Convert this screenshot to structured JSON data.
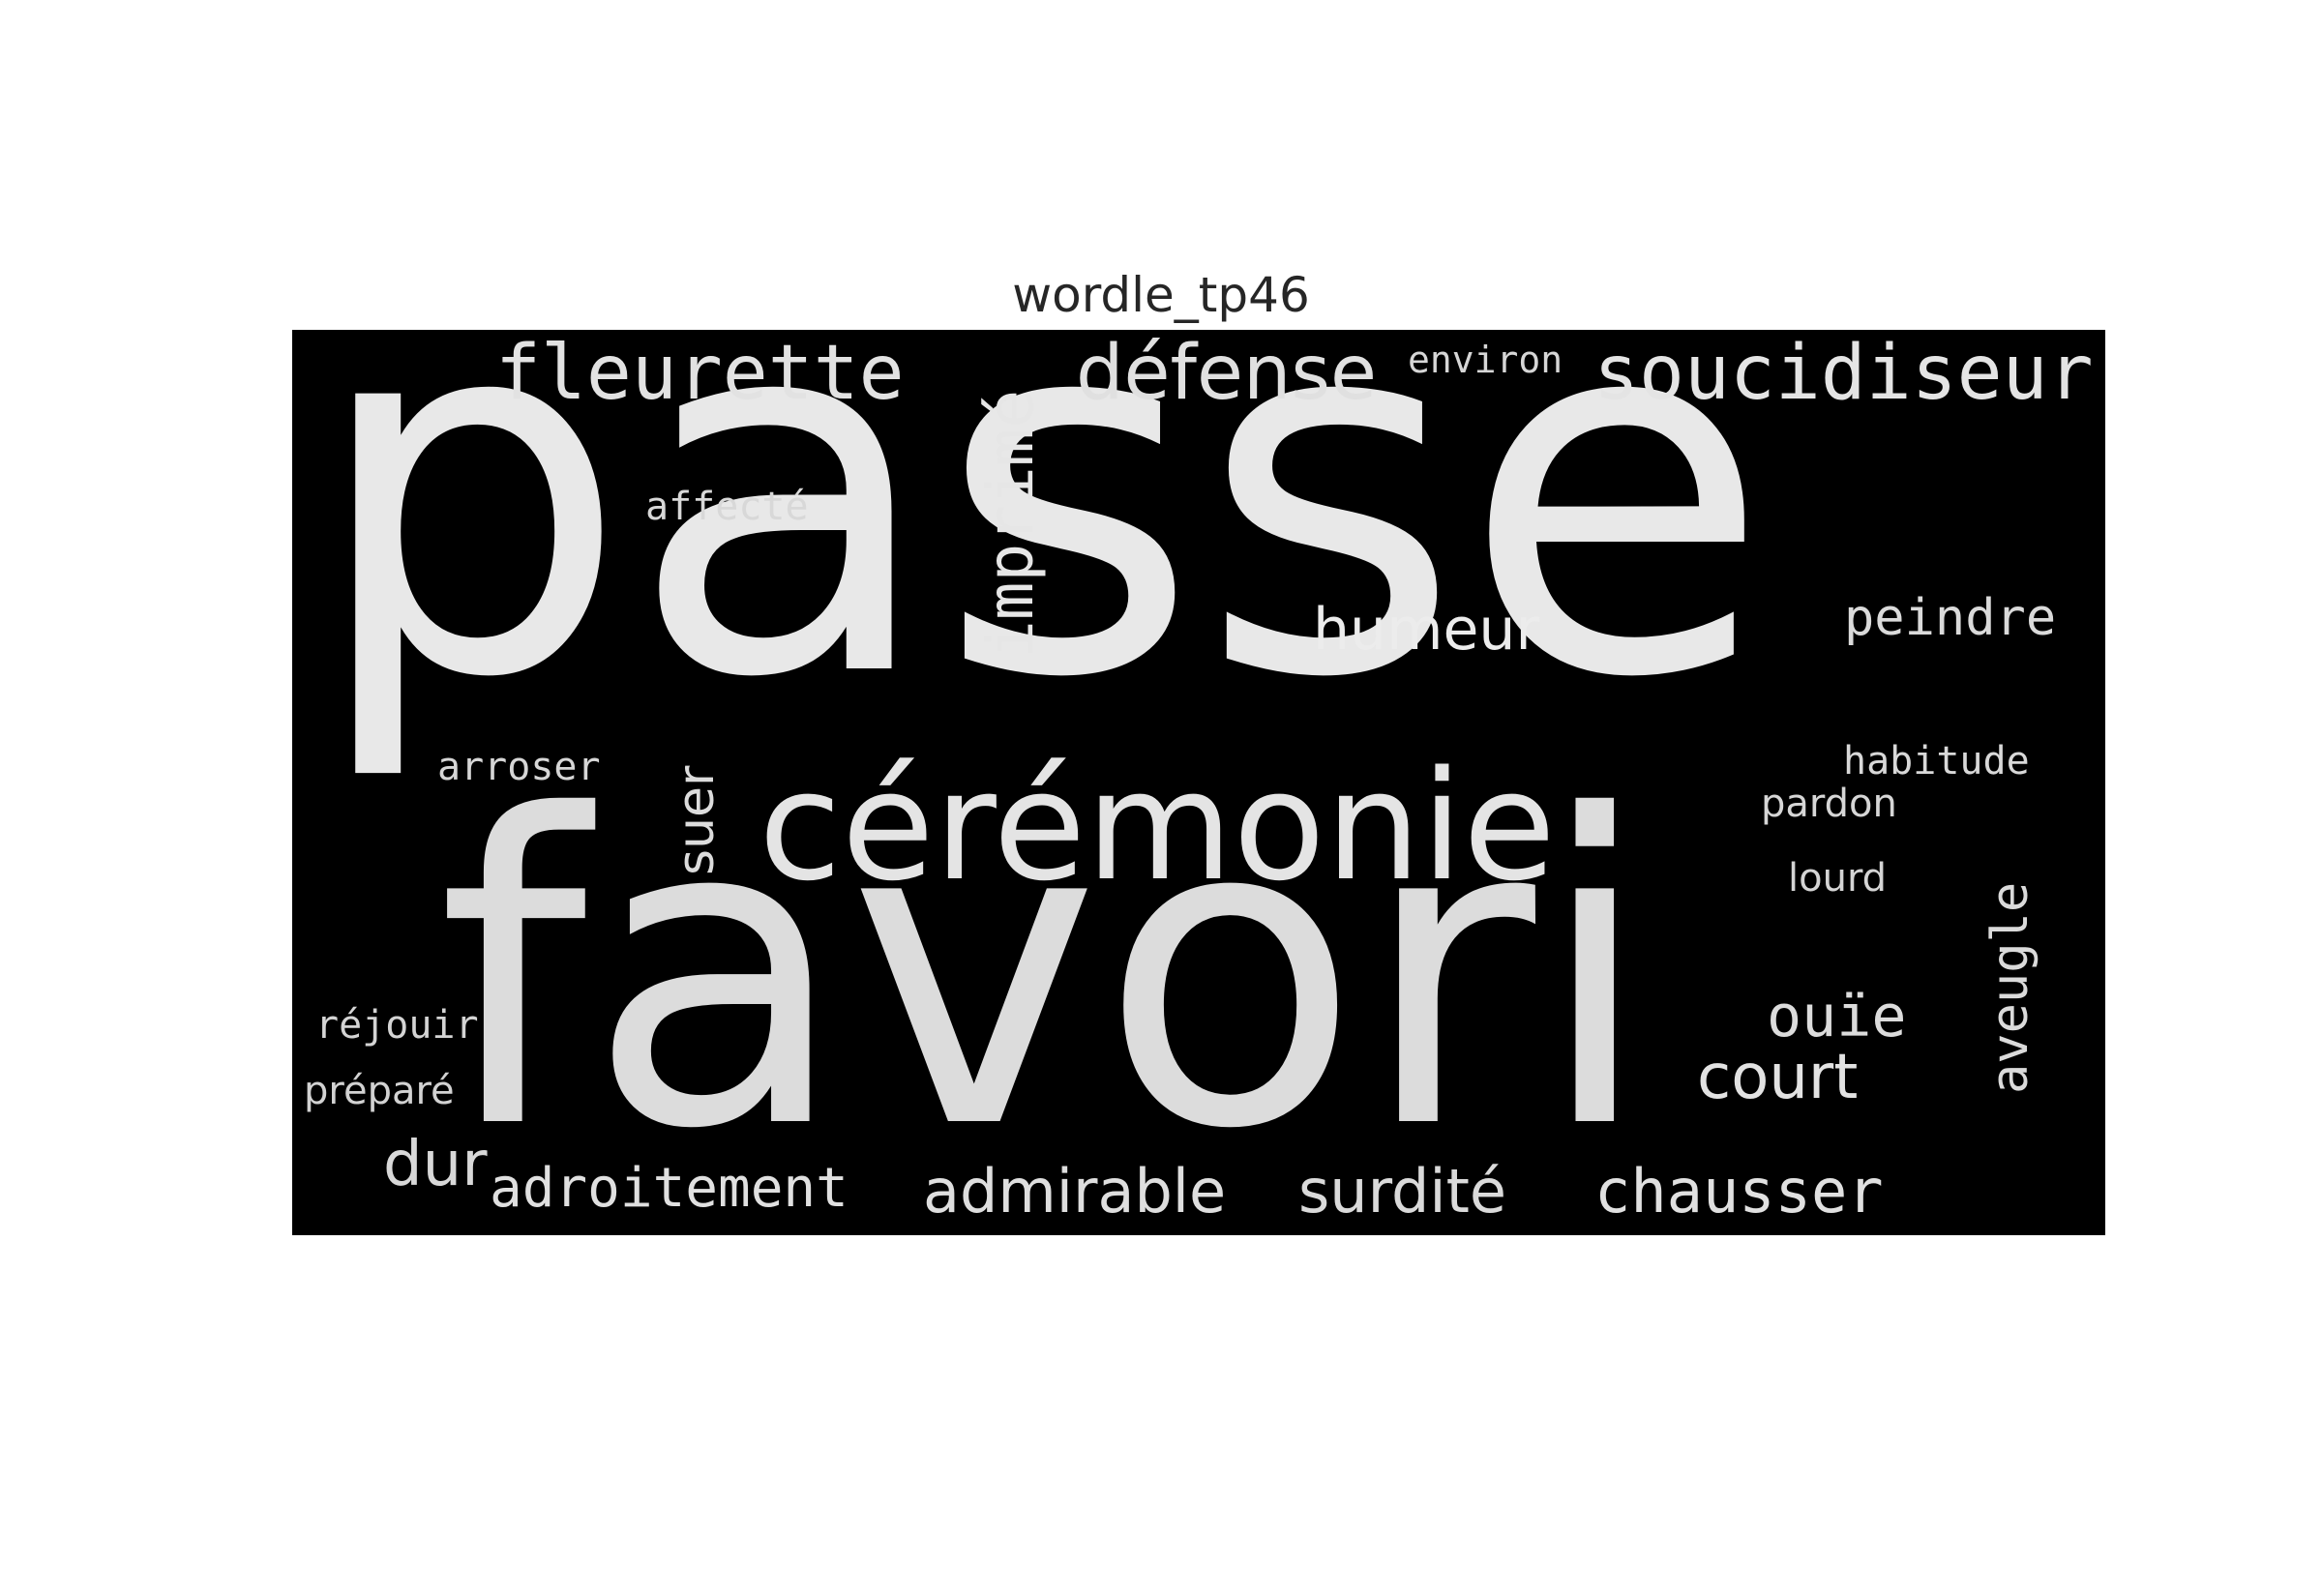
{
  "title": "wordle_tp46",
  "words": [
    {
      "text": "passe",
      "color": "#e8e8e8"
    },
    {
      "text": "favori",
      "color": "#dcdcdc"
    },
    {
      "text": "cérémonie",
      "color": "#e4e4e4"
    },
    {
      "text": "fleurette",
      "color": "#e2e2e2"
    },
    {
      "text": "imprimé",
      "color": "#e6e6e6"
    },
    {
      "text": "défense",
      "color": "#e0e0e0"
    },
    {
      "text": "environ",
      "color": "#d6d6d6"
    },
    {
      "text": "soucidiseur",
      "color": "#e4e4e4"
    },
    {
      "text": "affecté",
      "color": "#d8d8d8"
    },
    {
      "text": "humeur",
      "color": "#ececec"
    },
    {
      "text": "peindre",
      "color": "#dadada"
    },
    {
      "text": "arroser",
      "color": "#d6d6d6"
    },
    {
      "text": "suer",
      "color": "#dcdcdc"
    },
    {
      "text": "habitude",
      "color": "#d8d8d8"
    },
    {
      "text": "pardon",
      "color": "#d6d6d6"
    },
    {
      "text": "lourd",
      "color": "#d4d4d4"
    },
    {
      "text": "aveugle",
      "color": "#dadada"
    },
    {
      "text": "ouïe",
      "color": "#dcdcdc"
    },
    {
      "text": "court",
      "color": "#e2e2e2"
    },
    {
      "text": "réjouir",
      "color": "#d4d4d4"
    },
    {
      "text": "préparé",
      "color": "#d2d2d2"
    },
    {
      "text": "dur",
      "color": "#d8d8d8"
    },
    {
      "text": "adroitement",
      "color": "#e0e0e0"
    },
    {
      "text": "admirable",
      "color": "#dedede"
    },
    {
      "text": "surdité",
      "color": "#dadada"
    },
    {
      "text": "chausser",
      "color": "#e0e0e0"
    }
  ]
}
